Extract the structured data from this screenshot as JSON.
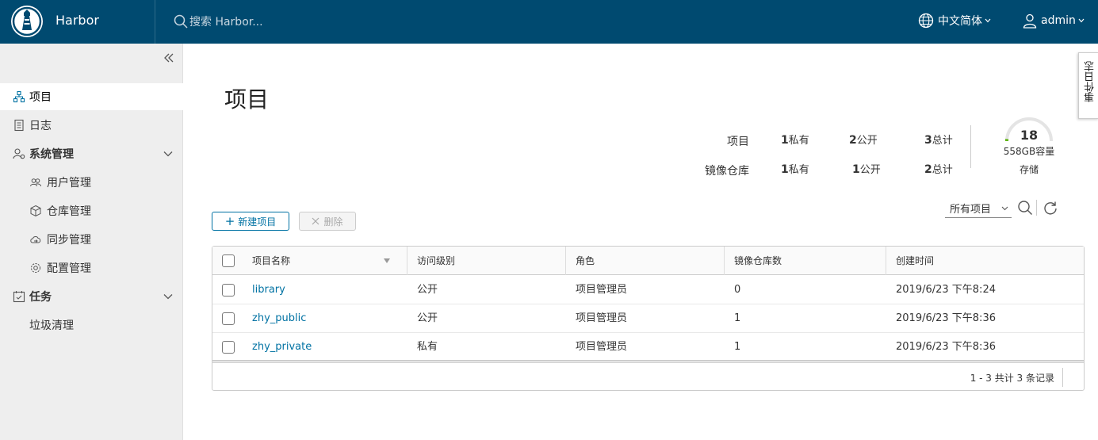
{
  "header": {
    "brand": "Harbor",
    "search_placeholder": "搜索 Harbor...",
    "language": "中文简体",
    "user": "admin",
    "bg_color": "#004a70"
  },
  "sidebar": {
    "items": [
      {
        "label": "项目",
        "icon": "projects-icon",
        "active": true
      },
      {
        "label": "日志",
        "icon": "log-icon"
      },
      {
        "label": "系统管理",
        "icon": "admin-icon",
        "group": true
      },
      {
        "label": "用户管理",
        "icon": "users-icon"
      },
      {
        "label": "仓库管理",
        "icon": "registry-icon"
      },
      {
        "label": "同步管理",
        "icon": "replication-icon"
      },
      {
        "label": "配置管理",
        "icon": "settings-icon"
      },
      {
        "label": "任务",
        "icon": "tasks-icon",
        "group": true
      },
      {
        "label": "垃圾清理"
      }
    ]
  },
  "main": {
    "title": "项目",
    "event_log_tab": "事件日志",
    "stats": {
      "projects_label": "项目",
      "repos_label": "镜像仓库",
      "projects": {
        "private": "1",
        "public": "2",
        "total": "3"
      },
      "repos": {
        "private": "1",
        "public": "1",
        "total": "2"
      },
      "private_label": "私有",
      "public_label": "公开",
      "total_label": "总计"
    },
    "storage": {
      "value": "18",
      "capacity": "558GB容量",
      "label": "存储",
      "fraction": 0.03
    },
    "toolbar": {
      "new_label": "新建项目",
      "delete_label": "删除",
      "filter_value": "所有项目"
    },
    "table": {
      "columns": [
        "项目名称",
        "访问级别",
        "角色",
        "镜像仓库数",
        "创建时间"
      ],
      "rows": [
        {
          "name": "library",
          "access": "公开",
          "role": "项目管理员",
          "repos": "0",
          "created": "2019/6/23 下午8:24"
        },
        {
          "name": "zhy_public",
          "access": "公开",
          "role": "项目管理员",
          "repos": "1",
          "created": "2019/6/23 下午8:36"
        },
        {
          "name": "zhy_private",
          "access": "私有",
          "role": "项目管理员",
          "repos": "1",
          "created": "2019/6/23 下午8:36"
        }
      ],
      "footer": "1 - 3 共计 3 条记录"
    }
  }
}
